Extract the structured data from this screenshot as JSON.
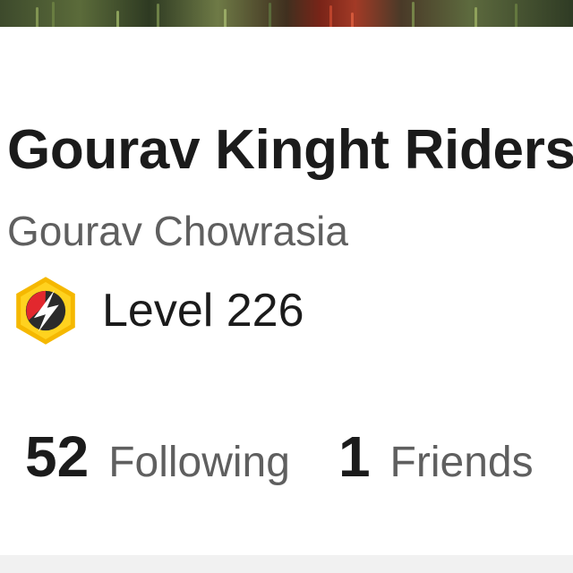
{
  "profile": {
    "team_name": "Gourav Kinght Riders",
    "owner_name": "Gourav Chowrasia",
    "level_label": "Level 226",
    "level_icon": "bolt-badge-icon"
  },
  "stats": {
    "following_count": "52",
    "following_label": "Following",
    "friends_count": "1",
    "friends_label": "Friends"
  },
  "colors": {
    "primary_text": "#1b1b1b",
    "secondary_text": "#5f5f5f",
    "badge_gold": "#f5b800",
    "badge_red": "#e2282e"
  }
}
